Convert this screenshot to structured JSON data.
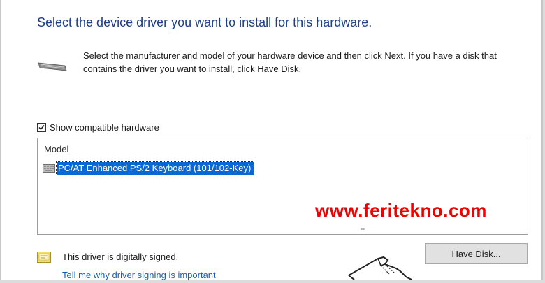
{
  "dialog": {
    "heading": "Select the device driver you want to install for this hardware.",
    "description": "Select the manufacturer and model of your hardware device and then click Next. If you have a disk that contains the driver you want to install, click Have Disk.",
    "hardware_icon": "keyboard-device-icon"
  },
  "compatible": {
    "label": "Show compatible hardware",
    "checked": true
  },
  "model_list": {
    "header": "Model",
    "items": [
      {
        "label": "PC/AT Enhanced PS/2 Keyboard (101/102-Key)",
        "icon": "keyboard-icon",
        "selected": true
      }
    ]
  },
  "watermark": "www.feritekno.com",
  "signing": {
    "status": "This driver is digitally signed.",
    "icon": "certificate-icon",
    "link": "Tell me why driver signing is important"
  },
  "buttons": {
    "have_disk": "Have Disk..."
  },
  "colors": {
    "heading": "#1f3f8a",
    "selection": "#0a68d6",
    "link": "#1a5fb4",
    "watermark": "#f00000"
  }
}
